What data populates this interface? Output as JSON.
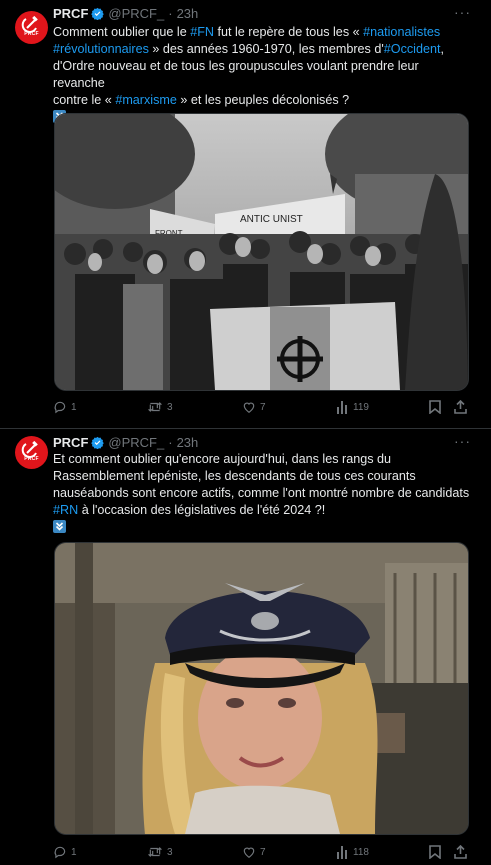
{
  "tweets": [
    {
      "author_name": "PRCF",
      "handle": "@PRCF_",
      "dot": "·",
      "time": "23h",
      "avatar_label": "PRCF",
      "text_parts": [
        "Comment oublier que le ",
        "#FN",
        " fut le repère de tous les « ",
        "#nationalistes",
        "#révolutionnaires",
        " » des années 1960-1970, les membres d'",
        "#Occident",
        ",",
        "d'Ordre nouveau et de tous les groupuscules voulant prendre leur revanche",
        "contre le « ",
        "#marxisme",
        " » et les peuples décolonisés ?"
      ],
      "media_banner_text": "FRONT",
      "media_sign_text": "ANTIC  UNIST",
      "actions": {
        "replies": "1",
        "reposts": "3",
        "likes": "7",
        "views": "119"
      }
    },
    {
      "author_name": "PRCF",
      "handle": "@PRCF_",
      "dot": "·",
      "time": "23h",
      "avatar_label": "PRCF",
      "text_lines": [
        "Et comment oublier qu'encore aujourd'hui, dans les rangs du",
        "Rassemblement lepéniste, les descendants de tous ces courants",
        "nauséabonds sont encore actifs, comme l'ont montré nombre de candidats"
      ],
      "text_link": "#RN",
      "text_tail": " à l'occasion des législatives de l'été 2024 ?!",
      "actions": {
        "replies": "1",
        "reposts": "3",
        "likes": "7",
        "views": "118"
      }
    }
  ],
  "more_label": "···",
  "colors": {
    "link": "#1d9bf0",
    "muted": "#71767b",
    "avatar_bg": "#e0151b",
    "verified": "#1d9bf0"
  },
  "icons": [
    "verified-badge-icon",
    "more-icon",
    "reply-icon",
    "repost-icon",
    "like-icon",
    "views-icon",
    "bookmark-icon",
    "share-icon",
    "down-arrow-emoji-icon",
    "hammer-sickle-icon"
  ]
}
